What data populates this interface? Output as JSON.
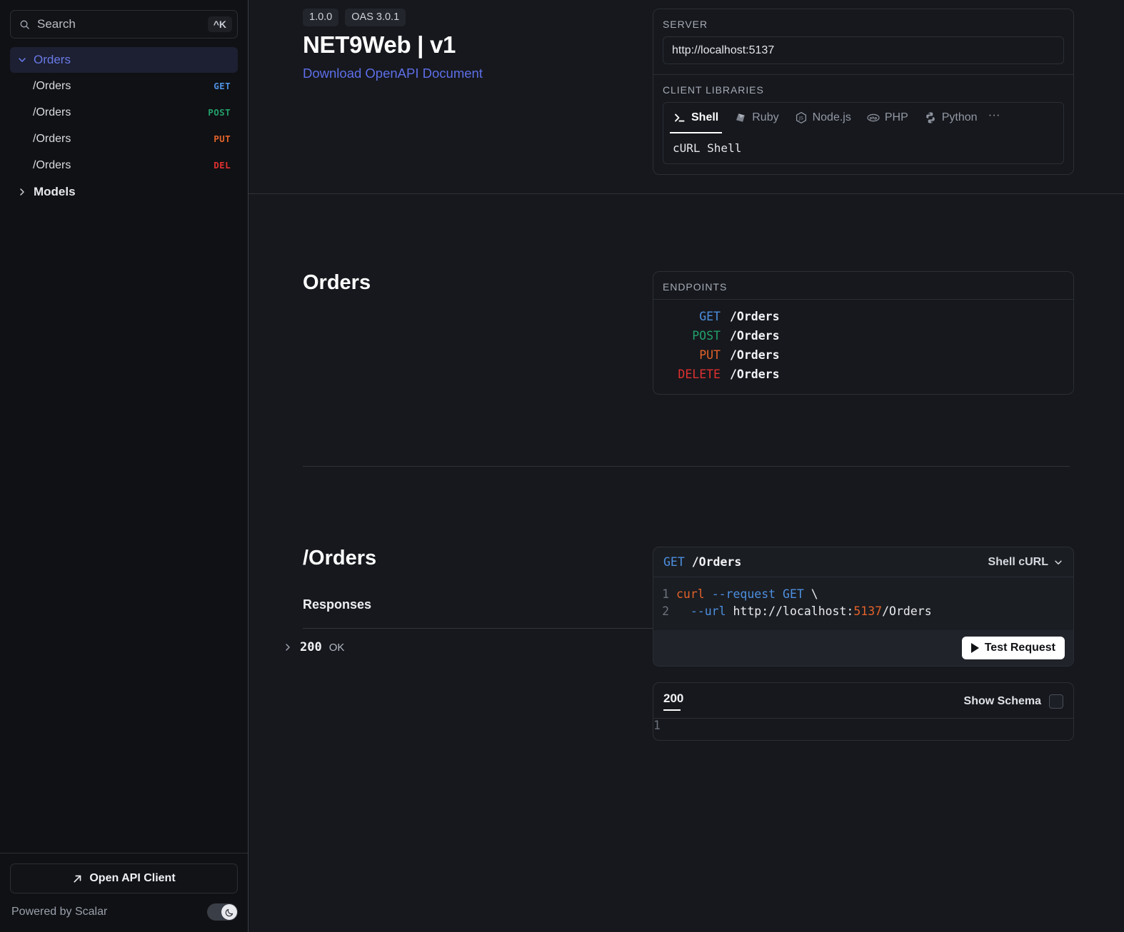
{
  "sidebar": {
    "search": {
      "placeholder": "Search",
      "shortcut": "^K",
      "icon": "search-icon"
    },
    "group": {
      "label": "Orders",
      "icon": "chevron-down-icon"
    },
    "endpoints": [
      {
        "path": "/Orders",
        "method": "GET",
        "method_class": "m-get"
      },
      {
        "path": "/Orders",
        "method": "POST",
        "method_class": "m-post"
      },
      {
        "path": "/Orders",
        "method": "PUT",
        "method_class": "m-put"
      },
      {
        "path": "/Orders",
        "method": "DEL",
        "method_class": "m-del"
      }
    ],
    "models": {
      "label": "Models",
      "icon": "chevron-right-icon"
    },
    "footer": {
      "open_client": "Open API Client",
      "open_client_icon": "arrow-up-right-icon",
      "powered_by": "Powered by Scalar",
      "theme_toggle_icon": "moon-icon"
    }
  },
  "header": {
    "version_badge": "1.0.0",
    "oas_badge": "OAS 3.0.1",
    "title": "NET9Web | v1",
    "download_link": "Download OpenAPI Document"
  },
  "server_card": {
    "server_label": "SERVER",
    "server_url": "http://localhost:5137",
    "client_libraries_label": "CLIENT LIBRARIES",
    "tabs": [
      {
        "label": "Shell",
        "icon": "terminal-icon",
        "active": true
      },
      {
        "label": "Ruby",
        "icon": "ruby-icon",
        "active": false
      },
      {
        "label": "Node.js",
        "icon": "nodejs-icon",
        "active": false
      },
      {
        "label": "PHP",
        "icon": "php-icon",
        "active": false
      },
      {
        "label": "Python",
        "icon": "python-icon",
        "active": false
      }
    ],
    "more_icon": "ellipsis-icon",
    "selected_client": "cURL Shell"
  },
  "tag_section": {
    "title": "Orders",
    "endpoints_label": "ENDPOINTS",
    "endpoints": [
      {
        "method": "GET",
        "method_class": "m-get",
        "path": "/Orders"
      },
      {
        "method": "POST",
        "method_class": "m-post",
        "path": "/Orders"
      },
      {
        "method": "PUT",
        "method_class": "m-put",
        "path": "/Orders"
      },
      {
        "method": "DELETE",
        "method_class": "m-del",
        "path": "/Orders"
      }
    ]
  },
  "operation": {
    "title": "/Orders",
    "responses_label": "Responses",
    "response": {
      "code": "200",
      "text": "OK",
      "chevron": "chevron-right-icon"
    },
    "code_panel": {
      "method": "GET",
      "path": "/Orders",
      "language": "Shell cURL",
      "language_chevron": "chevron-down-icon",
      "lines": [
        {
          "no": "1",
          "cmd": "curl",
          "flag": "--request",
          "plain": "GET",
          "tail": "\\"
        },
        {
          "no": "2",
          "flag": "--url",
          "plain_a": "http://localhost:",
          "num": "5137",
          "plain_b": "/Orders"
        }
      ],
      "test_button": "Test Request",
      "play_icon": "play-icon"
    },
    "response_panel": {
      "status_tab": "200",
      "show_schema": "Show Schema",
      "checkbox_checked": false,
      "line_no": "1"
    }
  },
  "colors": {
    "accent": "#5d6ee8",
    "get": "#4d8fe0",
    "post": "#22a06b",
    "put": "#e2622a",
    "delete": "#e03030",
    "background": "#16181d",
    "sidebar_bg": "#101114",
    "active_nav_bg": "#1c2032"
  }
}
